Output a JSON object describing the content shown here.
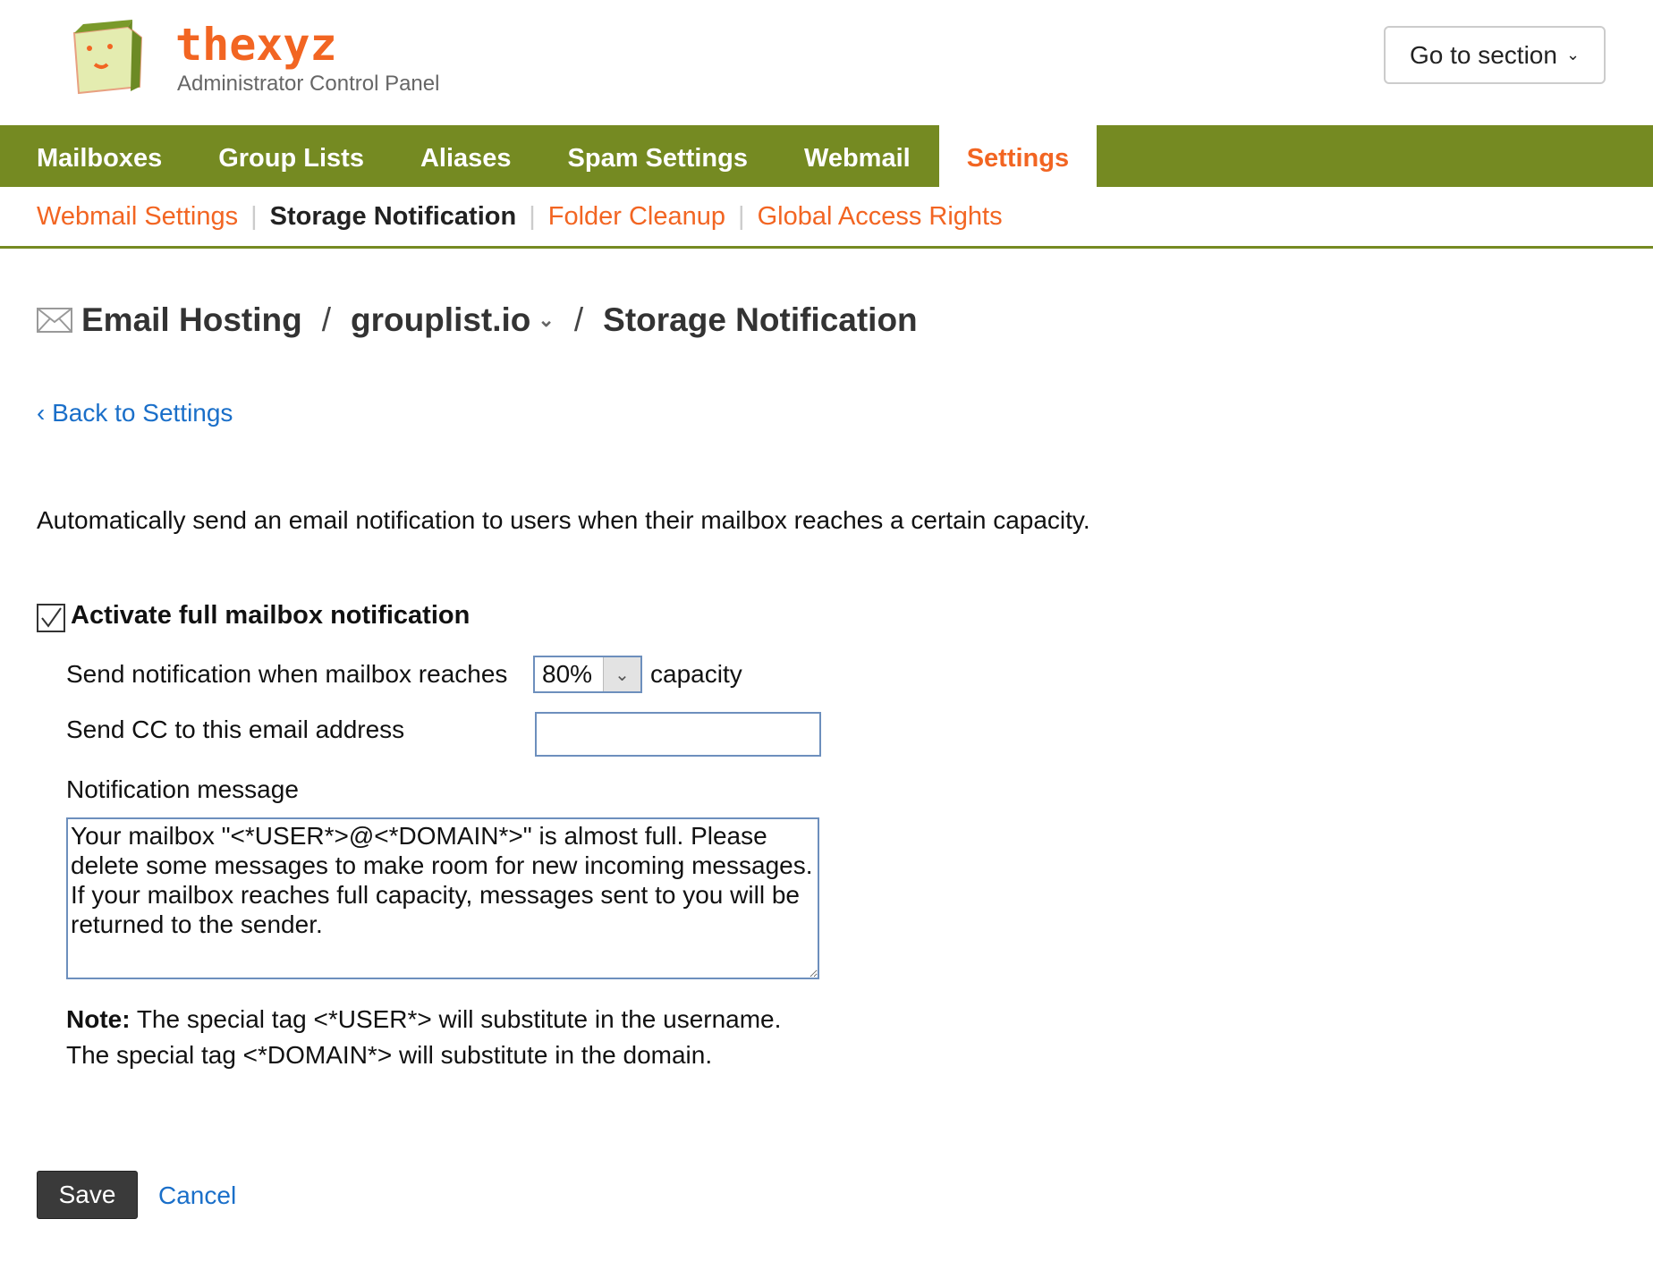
{
  "header": {
    "logo_text": "thexyz",
    "logo_subtitle": "Administrator Control Panel",
    "goto_label": "Go to section"
  },
  "nav": {
    "items": [
      {
        "label": "Mailboxes"
      },
      {
        "label": "Group Lists"
      },
      {
        "label": "Aliases"
      },
      {
        "label": "Spam Settings"
      },
      {
        "label": "Webmail"
      },
      {
        "label": "Settings",
        "active": true
      }
    ]
  },
  "subnav": {
    "items": [
      {
        "label": "Webmail Settings"
      },
      {
        "label": "Storage Notification",
        "active": true
      },
      {
        "label": "Folder Cleanup"
      },
      {
        "label": "Global Access Rights"
      }
    ]
  },
  "breadcrumb": {
    "root": "Email Hosting",
    "domain": "grouplist.io",
    "page": "Storage Notification"
  },
  "back_link": "‹ Back to Settings",
  "description": "Automatically send an email notification to users when their mailbox reaches a certain capacity.",
  "form": {
    "activate_label": "Activate full mailbox notification",
    "activate_checked": true,
    "threshold_label": "Send notification when mailbox reaches",
    "threshold_value": "80%",
    "threshold_suffix": "capacity",
    "cc_label": "Send CC to this email address",
    "cc_value": "",
    "message_label": "Notification message",
    "message_value": "Your mailbox \"<*USER*>@<*DOMAIN*>\" is almost full. Please delete some messages to make room for new incoming messages. If your mailbox reaches full capacity, messages sent to you will be returned to the sender.",
    "note_bold": "Note:",
    "note_line1": " The special tag <*USER*> will substitute in the username.",
    "note_line2": "The special tag <*DOMAIN*> will substitute in the domain."
  },
  "actions": {
    "save": "Save",
    "cancel": "Cancel"
  },
  "colors": {
    "nav_green": "#758a22",
    "accent_orange": "#f26522",
    "link_blue": "#1a6fc9"
  }
}
